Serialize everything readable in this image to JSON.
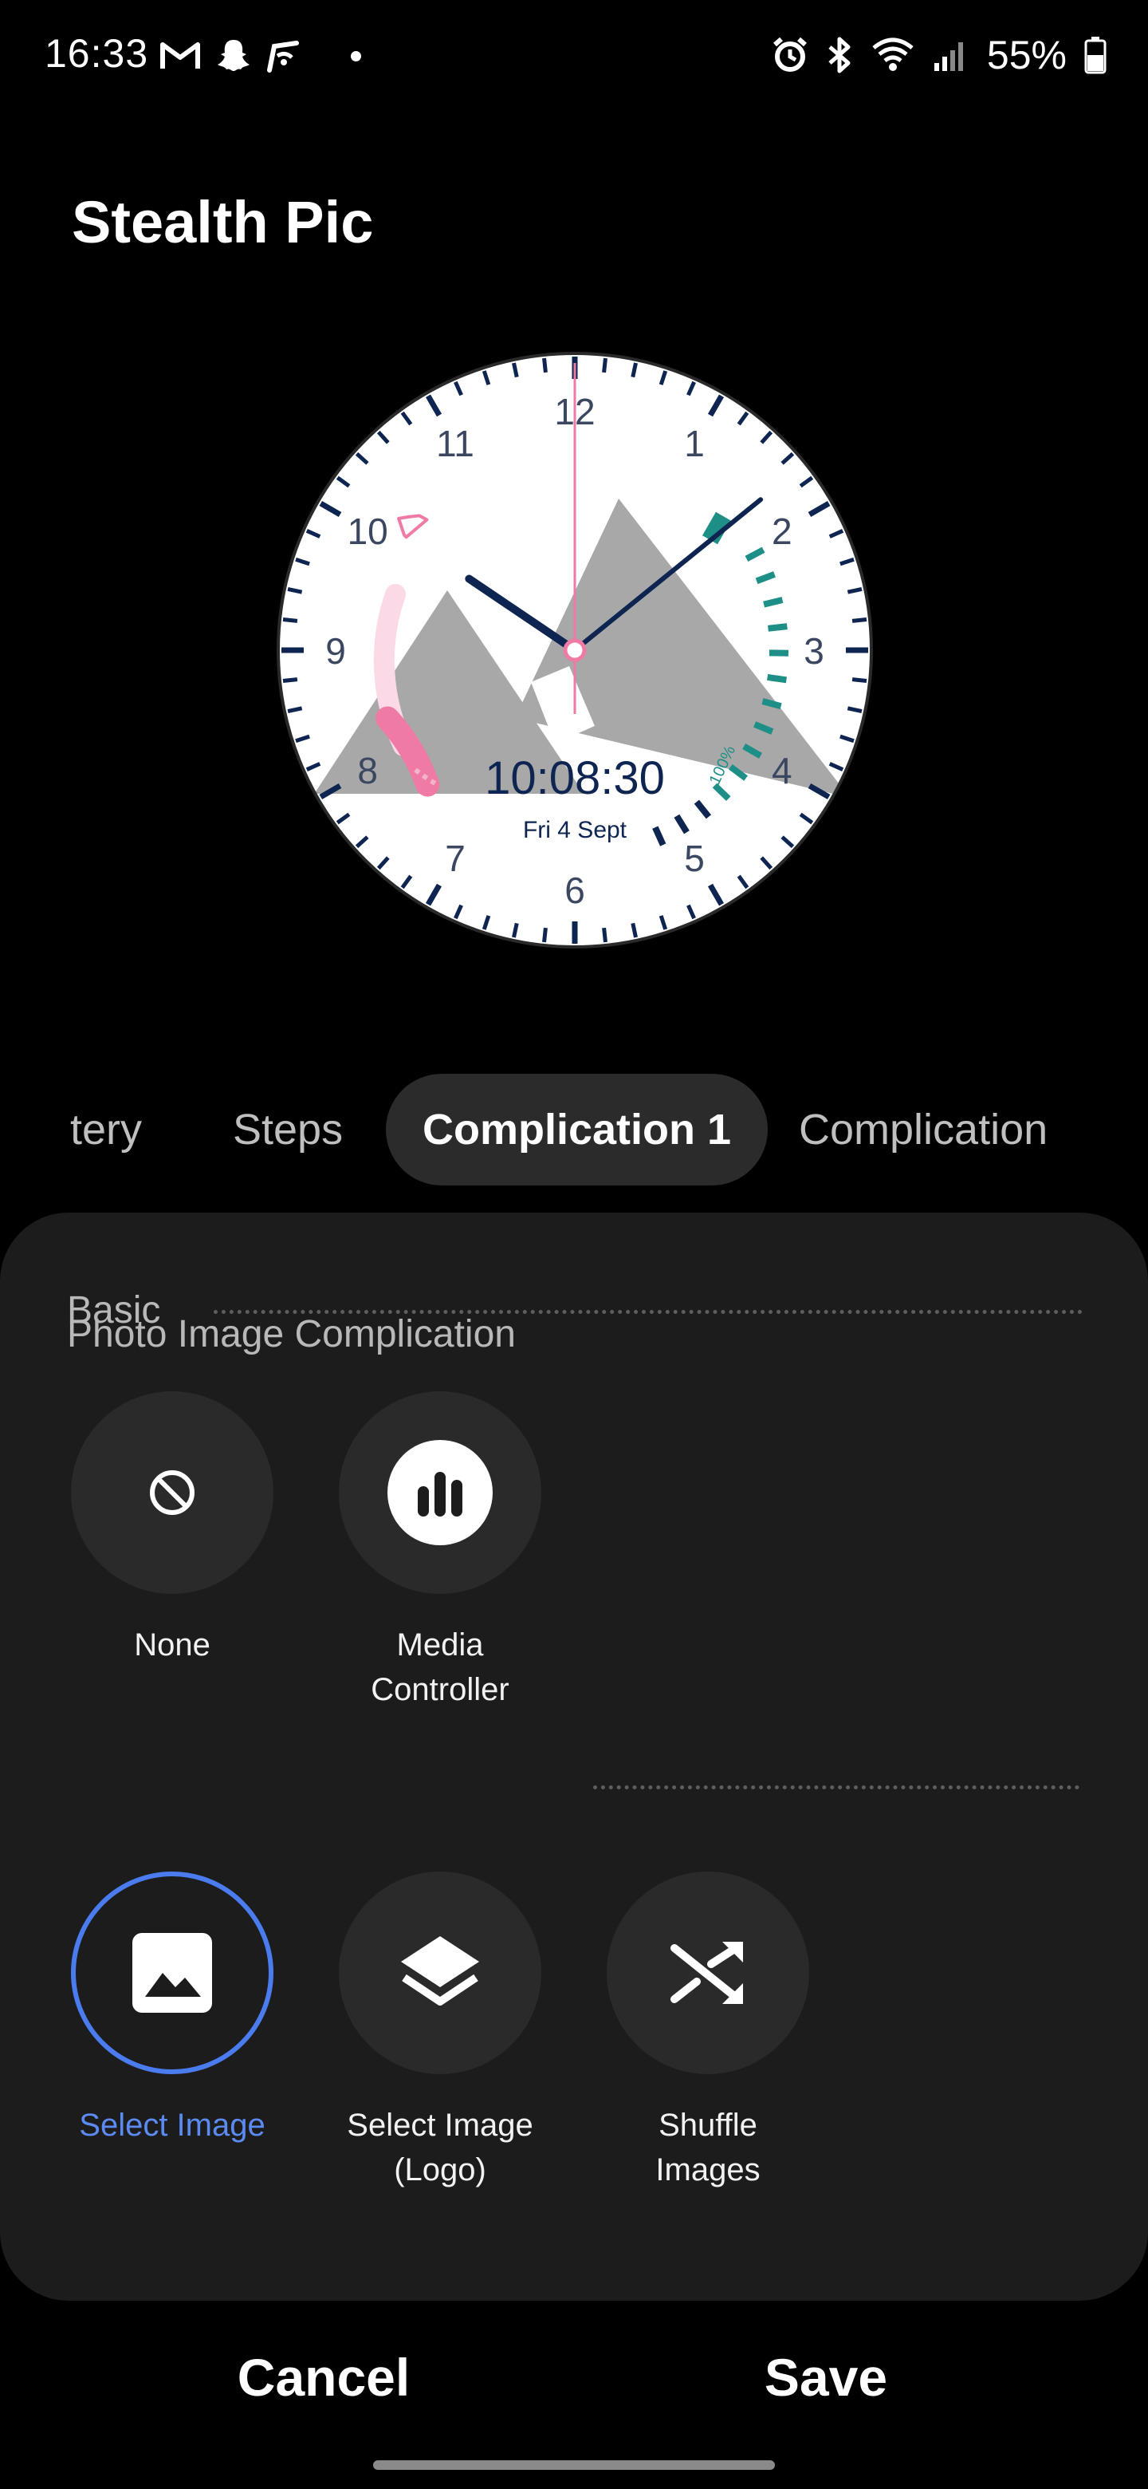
{
  "status_bar": {
    "time": "16:33",
    "left_icons": [
      "gmail-icon",
      "snapchat-icon",
      "wifi-calling-icon",
      "notification-dot"
    ],
    "right_icons": [
      "alarm-icon",
      "bluetooth-icon",
      "wifi-icon",
      "signal-icon"
    ],
    "battery_percent": "55%"
  },
  "page": {
    "title": "Stealth Pic"
  },
  "watch_face": {
    "numbers": [
      "12",
      "1",
      "2",
      "3",
      "4",
      "5",
      "6",
      "7",
      "8",
      "9",
      "10",
      "11"
    ],
    "digital_time": "10:08:30",
    "date": "Fri 4 Sept",
    "battery_label": "100%",
    "steps_progress": 0.35,
    "battery_progress": 1.0,
    "hands": {
      "hour": 10,
      "minute": 8,
      "second": 30
    },
    "colors": {
      "accent_pink": "#f07aa6",
      "accent_teal": "#1e8f86",
      "hands": "#0d2550",
      "mountains": "#a8a8a8"
    }
  },
  "tabs": [
    {
      "label": "tery",
      "active": false
    },
    {
      "label": "Steps",
      "active": false
    },
    {
      "label": "Complication 1",
      "active": true
    },
    {
      "label": "Complication",
      "active": false
    }
  ],
  "sections": {
    "basic": {
      "header": "Basic",
      "options": [
        {
          "label": "None",
          "icon": "none-icon",
          "selected": false
        },
        {
          "label": "Media\nController",
          "icon": "media-bars-icon",
          "selected": false
        }
      ]
    },
    "photo": {
      "header": "Photo Image Complication",
      "options": [
        {
          "label": "Select Image",
          "icon": "image-icon",
          "selected": true
        },
        {
          "label": "Select Image\n(Logo)",
          "icon": "layers-icon",
          "selected": false
        },
        {
          "label": "Shuffle\nImages",
          "icon": "shuffle-icon",
          "selected": false
        }
      ]
    }
  },
  "buttons": {
    "cancel": "Cancel",
    "save": "Save"
  },
  "colors": {
    "selection_blue": "#4a7cf0",
    "sheet_bg": "#1c1c1c",
    "chip_bg": "#2b2b2b"
  }
}
